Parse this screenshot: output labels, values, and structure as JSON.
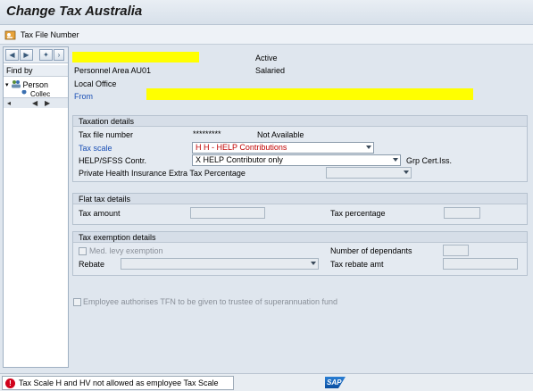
{
  "window": {
    "title": "Change Tax Australia"
  },
  "toolbar": {
    "tax_file_number_label": "Tax File Number",
    "icon": "tax-file-icon"
  },
  "nav": {
    "find_by": "Find by",
    "tree": {
      "person": "Person",
      "collection": "Collec"
    }
  },
  "header": {
    "status": "Active",
    "personnel_area": "Personnel Area AU01",
    "employee_type": "Salaried",
    "local_office": "Local Office",
    "from_label": "From"
  },
  "taxation": {
    "title": "Taxation details",
    "tfn_label": "Tax file number",
    "tfn_value": "*********",
    "tfn_status": "Not Available",
    "tax_scale_label": "Tax scale",
    "tax_scale_value": "H H - HELP Contributions",
    "help_label": "HELP/SFSS Contr.",
    "help_value": "X HELP Contributor only",
    "grp_cert_label": "Grp Cert.Iss.",
    "phi_label": "Private Health Insurance Extra Tax Percentage",
    "phi_value": ""
  },
  "flat_tax": {
    "title": "Flat tax details",
    "amount_label": "Tax amount",
    "percentage_label": "Tax percentage"
  },
  "exemption": {
    "title": "Tax exemption details",
    "medicare_label": "Med. levy exemption",
    "dependants_label": "Number of dependants",
    "rebate_label": "Rebate",
    "rebate_value": "",
    "rebate_amt_label": "Tax rebate amt"
  },
  "tfn_trustee_label": "Employee authorises TFN to be given to trustee of superannuation fund",
  "status_bar": {
    "message": "Tax Scale H and HV not allowed as employee Tax Scale",
    "logo_text": "SAP"
  },
  "colors": {
    "error_red": "#d0021b",
    "link_blue": "#1a4fb5",
    "highlight_yellow": "#ffff00",
    "tax_scale_text": "#c00000"
  }
}
